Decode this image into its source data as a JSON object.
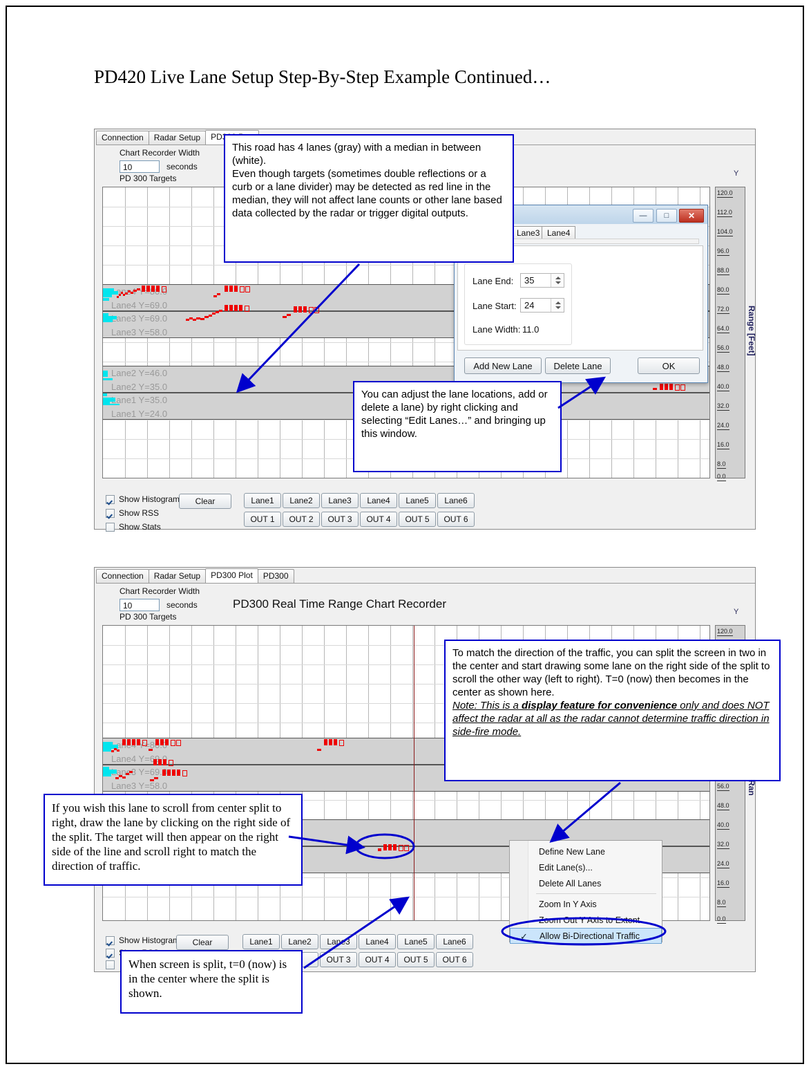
{
  "page": {
    "title": "PD420 Live Lane Setup Step-By-Step Example Continued…"
  },
  "panel1": {
    "tabs": [
      {
        "label": "Connection",
        "active": false
      },
      {
        "label": "Radar Setup",
        "active": false
      },
      {
        "label": "PD300 P",
        "active": true
      },
      {
        "label": "",
        "active": false
      }
    ],
    "chart_recorder_width_label": "Chart Recorder Width",
    "width_value": "10",
    "seconds_label": "seconds",
    "targets_label": "PD 300 Targets",
    "y_label": "Y",
    "range_axis_label": "Range [Feet]",
    "lane_texts": [
      "Lane4 Y=80.0",
      "Lane4 Y=69.0",
      "Lane3 Y=69.0",
      "Lane3 Y=58.0",
      "Lane2 Y=46.0",
      "Lane2 Y=35.0",
      "Lane1 Y=35.0",
      "Lane1 Y=24.0"
    ],
    "checkboxes": [
      {
        "label": "Show Histogram",
        "checked": true
      },
      {
        "label": "Show RSS",
        "checked": true
      },
      {
        "label": "Show Stats",
        "checked": false
      }
    ],
    "clear_label": "Clear",
    "lane_buttons": [
      "Lane1",
      "Lane2",
      "Lane3",
      "Lane4",
      "Lane5",
      "Lane6"
    ],
    "out_buttons": [
      "OUT 1",
      "OUT 2",
      "OUT 3",
      "OUT 4",
      "OUT 5",
      "OUT 6"
    ]
  },
  "dialog": {
    "tabs": [
      "Lane3",
      "Lane4"
    ],
    "fields": [
      {
        "label": "Lane End:",
        "value": "35",
        "type": "spin"
      },
      {
        "label": "Lane Start:",
        "value": "24",
        "type": "spin"
      },
      {
        "label": "Lane Width:",
        "value": "11.0",
        "type": "text"
      }
    ],
    "buttons": [
      "Add New Lane",
      "Delete Lane",
      "OK"
    ],
    "window_buttons": [
      "—",
      "□",
      "✕"
    ]
  },
  "panel2": {
    "tabs": [
      {
        "label": "Connection",
        "active": false
      },
      {
        "label": "Radar Setup",
        "active": false
      },
      {
        "label": "PD300 Plot",
        "active": true
      },
      {
        "label": "PD300",
        "active": false
      }
    ],
    "chart_recorder_width_label": "Chart Recorder Width",
    "width_value": "10",
    "seconds_label": "seconds",
    "targets_label": "PD 300 Targets",
    "chart_title": "PD300 Real Time Range Chart Recorder",
    "y_label": "Y",
    "range_axis_label": "Ran",
    "lane_texts": [
      "Lane4 Y=80.0",
      "Lane4 Y=69.0",
      "Lane3 Y=69.0",
      "Lane3 Y=58.0"
    ],
    "checkboxes": [
      {
        "label": "Show Histogram",
        "checked": true
      },
      {
        "label": "Show RSS",
        "checked": true
      },
      {
        "label": "",
        "checked": false
      }
    ],
    "clear_label": "Clear",
    "lane_buttons": [
      "Lane1",
      "Lane2",
      "Lane3",
      "Lane4",
      "Lane5",
      "Lane6"
    ],
    "out_buttons": [
      "2",
      "OUT 3",
      "OUT 4",
      "OUT 5",
      "OUT 6"
    ]
  },
  "context_menu": {
    "items": [
      {
        "label": "Define New Lane",
        "checked": false,
        "selected": false,
        "separator_after": false
      },
      {
        "label": "Edit Lane(s)...",
        "checked": false,
        "selected": false,
        "separator_after": false
      },
      {
        "label": "Delete All Lanes",
        "checked": false,
        "selected": false,
        "separator_after": true
      },
      {
        "label": "Zoom In Y Axis",
        "checked": false,
        "selected": false,
        "separator_after": false
      },
      {
        "label": "Zoom Out Y Axis to Extent",
        "checked": false,
        "selected": false,
        "separator_after": false
      },
      {
        "label": "Allow Bi-Directional Traffic",
        "checked": true,
        "selected": true,
        "separator_after": false
      }
    ],
    "check_glyph": "✓"
  },
  "callouts": {
    "c1": "This road has 4 lanes (gray) with a median in between (white).\nEven though targets (sometimes double reflections or a curb or a lane divider) may be detected as red line in the median, they will not affect lane counts or other lane based data collected by the radar or trigger digital outputs.",
    "c2": "You can adjust the lane locations, add or delete a lane) by right clicking and selecting “Edit Lanes…” and bringing up this window.",
    "c3_p1": "To match the direction of the traffic, you can split the screen in two in the center and start drawing some lane on the right side of the split to scroll the other way (left to right). T=0 (now) then becomes in the center as shown here.",
    "c3_note_a": "Note: This is a ",
    "c3_note_b": "display feature for convenience",
    "c3_note_c": " only and does NOT affect the radar at all as the radar cannot determine traffic direction in side-fire mode.",
    "c4": "If you wish this lane to scroll from center split to right, draw the lane by clicking on the right side of the split. The target will then appear on the right side of the line and scroll right to match the direction of traffic.",
    "c5": "When screen is split, t=0 (now) is in the center where the split is shown."
  },
  "yaxis_ticks": [
    "120.0",
    "112.0",
    "104.0",
    "96.0",
    "88.0",
    "80.0",
    "72.0",
    "64.0",
    "56.0",
    "48.0",
    "40.0",
    "32.0",
    "24.0",
    "16.0",
    "8.0",
    "0.0"
  ],
  "colors": {
    "callout_border": "#0000CD",
    "target_red": "#EE0000",
    "histogram_cyan": "#00E5EE",
    "split_line": "#8B1A1A",
    "lane_band": "#D2D2D2"
  },
  "chart_data": {
    "type": "line",
    "title": "PD300 Real Time Range Chart Recorder",
    "xlabel": "",
    "ylabel": "Range [Feet]",
    "ylim": [
      0,
      120
    ],
    "ytick_step": 8,
    "x_window_seconds": 10,
    "grid": true,
    "lanes": [
      {
        "name": "Lane1",
        "start": 24.0,
        "end": 35.0,
        "width": 11.0
      },
      {
        "name": "Lane2",
        "start": 35.0,
        "end": 46.0,
        "width": 11.0
      },
      {
        "name": "Lane3",
        "start": 58.0,
        "end": 69.0,
        "width": 11.0
      },
      {
        "name": "Lane4",
        "start": 69.0,
        "end": 80.0,
        "width": 11.0
      }
    ]
  }
}
